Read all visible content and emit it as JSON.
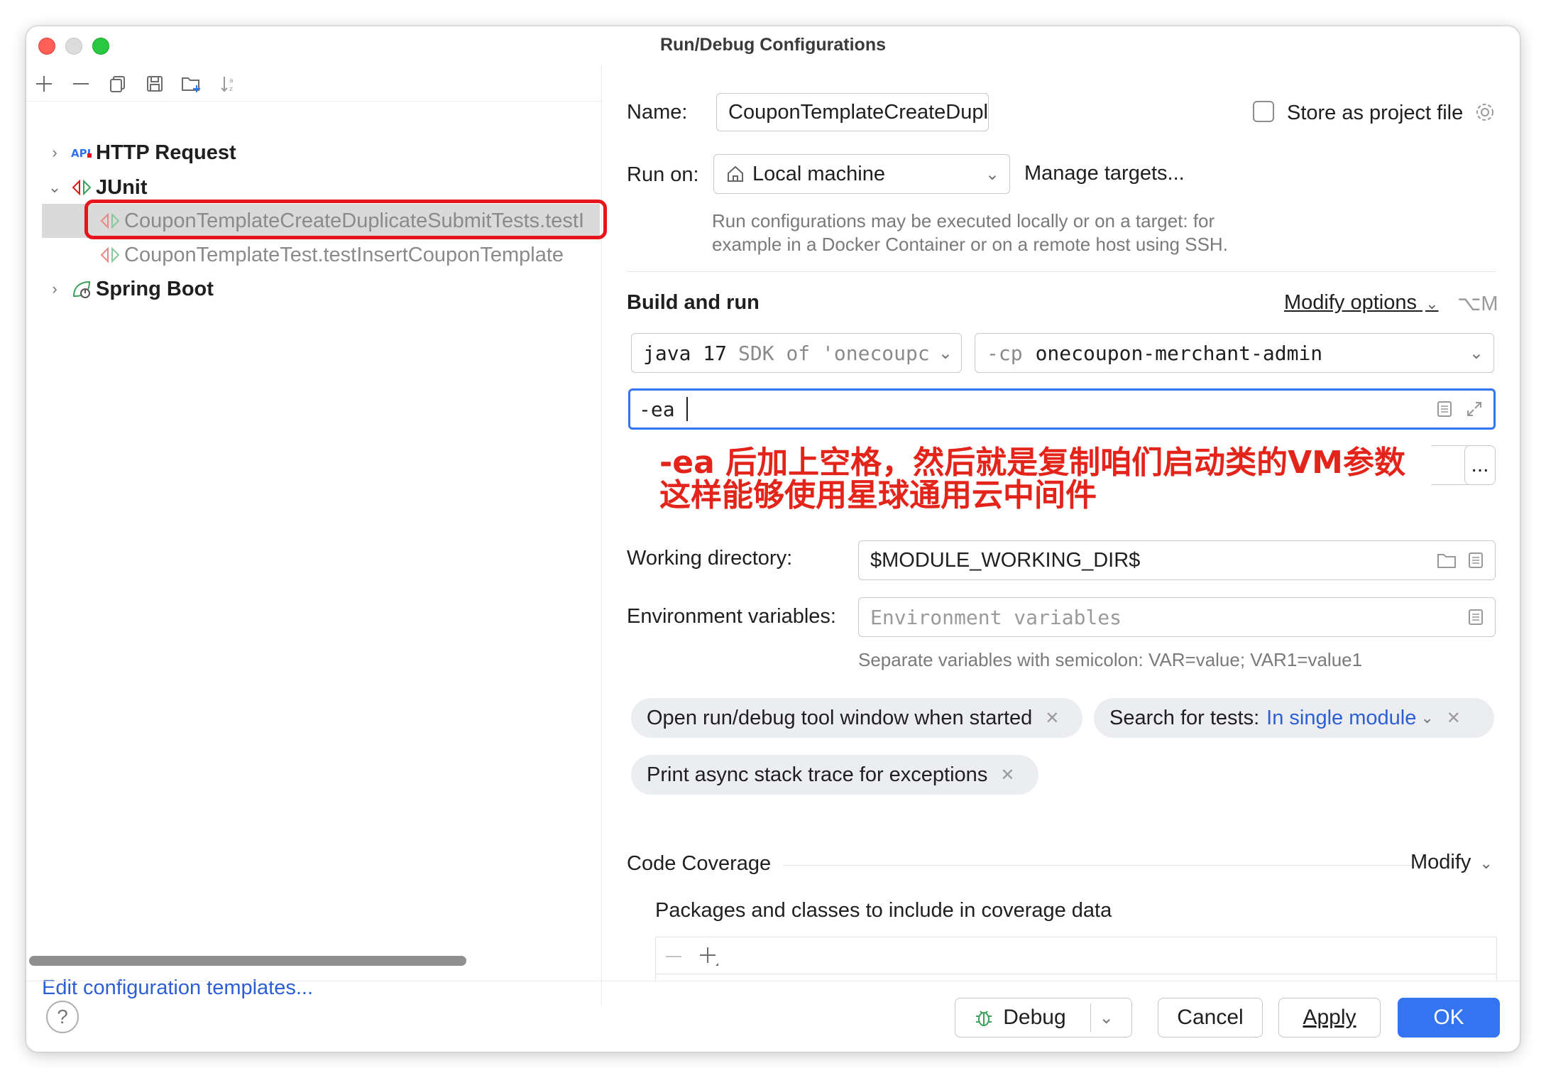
{
  "window": {
    "title": "Run/Debug Configurations"
  },
  "toolbar": {
    "icons": [
      "add-icon",
      "remove-icon",
      "copy-icon",
      "save-icon",
      "new-folder-icon",
      "sort-icon"
    ]
  },
  "tree": {
    "http_request": "HTTP Request",
    "junit": "JUnit",
    "junit_item_1": "CouponTemplateCreateDuplicateSubmitTests.testI",
    "junit_item_2": "CouponTemplateTest.testInsertCouponTemplate",
    "spring_boot": "Spring Boot"
  },
  "left_footer": {
    "edit_templates": "Edit configuration templates..."
  },
  "form": {
    "name_label": "Name:",
    "name_value": "CouponTemplateCreateDuplicateSubmitTests.te",
    "store_label": "Store as project file",
    "store_checked": false,
    "run_on_label": "Run on:",
    "run_on_value": "Local machine",
    "manage_targets": "Manage targets...",
    "run_on_help_1": "Run configurations may be executed locally or on a target: for",
    "run_on_help_2": "example in a Docker Container or on a remote host using SSH.",
    "build_run_title": "Build and run",
    "modify_options": "Modify options",
    "modify_shortcut": "⌥M",
    "jdk_java": "java 17",
    "jdk_rest": "SDK of 'onecoupc",
    "cp_flag": "-cp",
    "cp_value": "onecoupon-merchant-admin",
    "vm_options": "-ea",
    "more_button": "...",
    "working_dir_label": "Working directory:",
    "working_dir_value": "$MODULE_WORKING_DIR$",
    "env_label": "Environment variables:",
    "env_placeholder": "Environment variables",
    "env_help": "Separate variables with semicolon: VAR=value; VAR1=value1",
    "chip_open_window": "Open run/debug tool window when started",
    "chip_search_prefix": "Search for tests:",
    "chip_search_value": "In single module",
    "chip_async": "Print async stack trace for exceptions",
    "coverage_title": "Code Coverage",
    "coverage_modify": "Modify",
    "coverage_packages": "Packages and classes to include in coverage data"
  },
  "annotation": {
    "line1": "-ea 后加上空格，然后就是复制咱们启动类的VM参数",
    "line2": "这样能够使用星球通用云中间件"
  },
  "buttons": {
    "help": "?",
    "debug": "Debug",
    "cancel": "Cancel",
    "apply": "Apply",
    "ok": "OK"
  },
  "colors": {
    "accent": "#3574f0",
    "link": "#2c5fd4",
    "annotation_red": "#e3241b",
    "highlight_outline": "#e5151b"
  }
}
